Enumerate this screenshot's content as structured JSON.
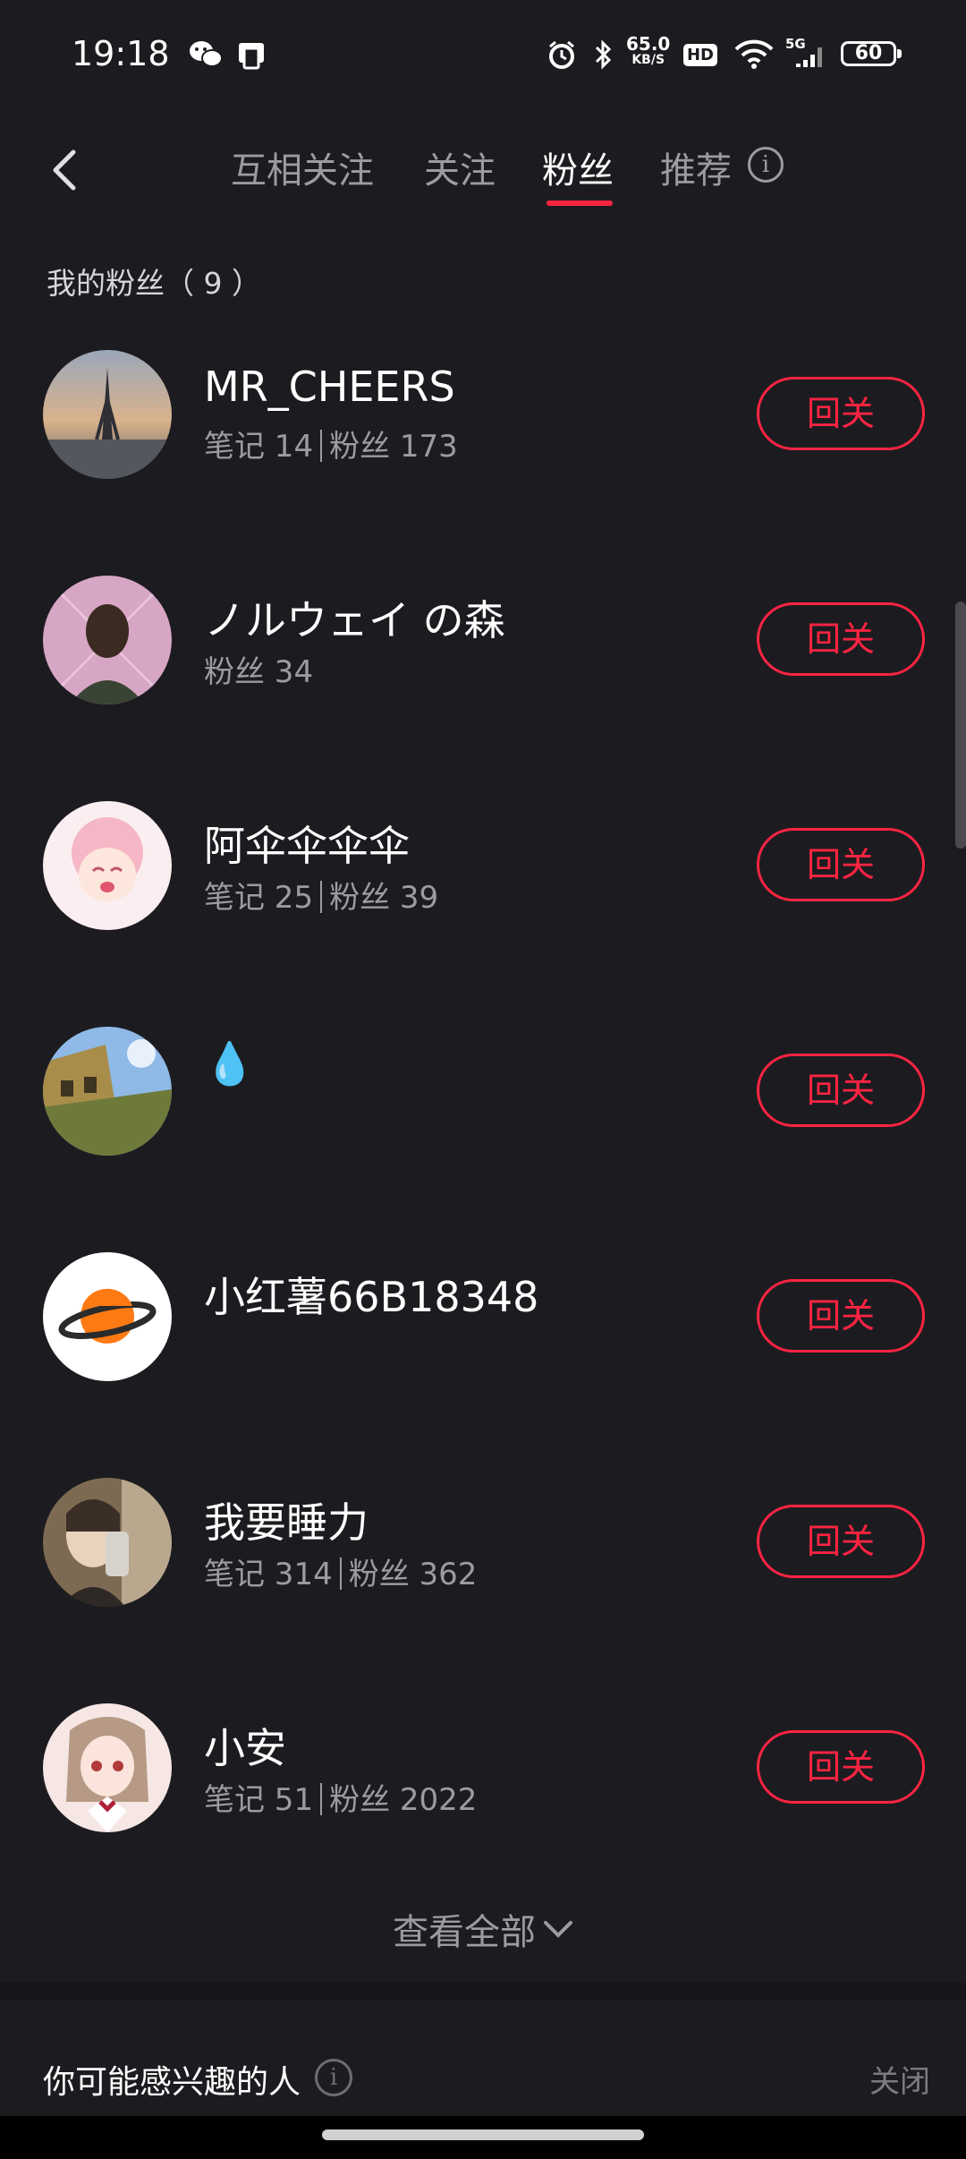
{
  "status_bar": {
    "time": "19:18",
    "net_speed_value": "65.0",
    "net_speed_unit": "KB/S",
    "hd_badge": "HD",
    "network_label": "5G",
    "battery": "60"
  },
  "nav": {
    "tabs": [
      {
        "label": "互相关注"
      },
      {
        "label": "关注"
      },
      {
        "label": "粉丝"
      },
      {
        "label": "推荐"
      }
    ],
    "active_tab": "粉丝"
  },
  "section_title": "我的粉丝（ 9 ）",
  "followers": [
    {
      "name": "MR_CHEERS",
      "notes": "笔记 14",
      "fans": "粉丝 173",
      "action": "回关"
    },
    {
      "name": "ノルウェイ の森",
      "notes": "",
      "fans": "粉丝 34",
      "action": "回关"
    },
    {
      "name": "阿伞伞伞伞",
      "notes": "笔记 25",
      "fans": "粉丝 39",
      "action": "回关"
    },
    {
      "name": "💧",
      "notes": "",
      "fans": "",
      "action": "回关"
    },
    {
      "name": "小红薯66B18348",
      "notes": "",
      "fans": "",
      "action": "回关"
    },
    {
      "name": "我要睡力",
      "notes": "笔记 314",
      "fans": "粉丝 362",
      "action": "回关"
    },
    {
      "name": "小安",
      "notes": "笔记 51",
      "fans": "粉丝 2022",
      "action": "回关"
    }
  ],
  "view_all": "查看全部",
  "suggestions": {
    "title": "你可能感兴趣的人",
    "close_label": "关闭"
  },
  "colors": {
    "background": "#1c1c20",
    "accent": "#ff2442",
    "muted_text": "#9b9ba2"
  }
}
